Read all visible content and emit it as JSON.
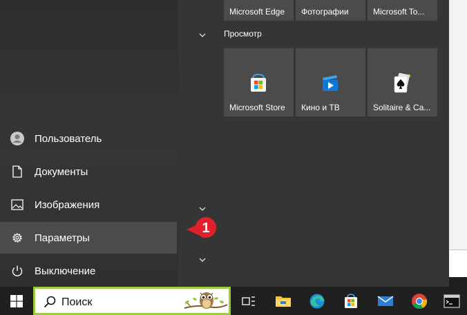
{
  "start_menu": {
    "items": [
      {
        "label": "Пользователь"
      },
      {
        "label": "Документы"
      },
      {
        "label": "Изображения"
      },
      {
        "label": "Параметры"
      },
      {
        "label": "Выключение"
      }
    ],
    "top_tiles": [
      {
        "label": "Microsoft Edge"
      },
      {
        "label": "Фотографии"
      },
      {
        "label": "Microsoft To..."
      }
    ],
    "group_label": "Просмотр",
    "tiles": [
      {
        "label": "Microsoft Store",
        "icon": "store-icon"
      },
      {
        "label": "Кино и ТВ",
        "icon": "movies-icon"
      },
      {
        "label": "Solitaire & Ca...",
        "icon": "solitaire-icon"
      }
    ]
  },
  "annotation": {
    "number": "1",
    "color": "#e0202a"
  },
  "taskbar": {
    "search_placeholder": "Поиск",
    "search_border": "#9ccc3c",
    "icons": [
      "task-view-icon",
      "file-explorer-icon",
      "edge-icon",
      "store-icon",
      "mail-icon",
      "chrome-icon",
      "terminal-icon"
    ]
  }
}
